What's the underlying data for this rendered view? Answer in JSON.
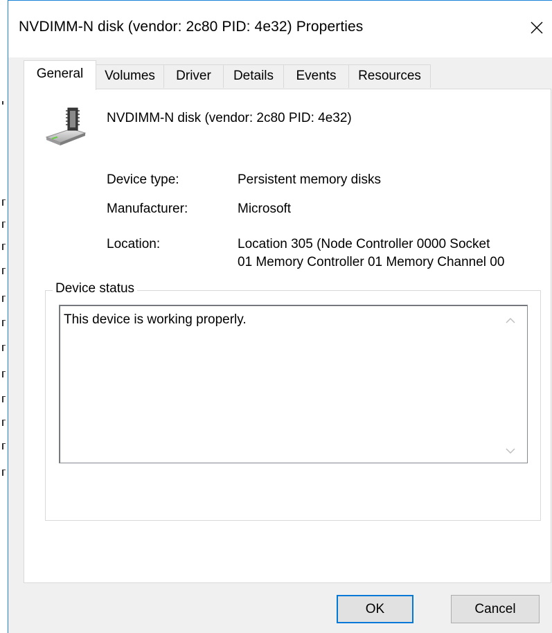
{
  "window": {
    "title": "NVDIMM-N disk (vendor: 2c80 PID: 4e32) Properties",
    "close_icon": "close-icon"
  },
  "tabs": [
    {
      "label": "General",
      "active": true
    },
    {
      "label": "Volumes",
      "active": false
    },
    {
      "label": "Driver",
      "active": false
    },
    {
      "label": "Details",
      "active": false
    },
    {
      "label": "Events",
      "active": false
    },
    {
      "label": "Resources",
      "active": false
    }
  ],
  "general": {
    "device_icon": "disk-drive-icon",
    "device_name": "NVDIMM-N disk (vendor: 2c80 PID: 4e32)",
    "properties": {
      "device_type_label": "Device type:",
      "device_type_value": "Persistent memory disks",
      "manufacturer_label": "Manufacturer:",
      "manufacturer_value": "Microsoft",
      "location_label": "Location:",
      "location_value_line1": "Location 305 (Node Controller 0000 Socket",
      "location_value_line2": "01 Memory Controller 01 Memory Channel 00"
    },
    "status": {
      "group_label": "Device status",
      "text": "This device is working properly."
    }
  },
  "buttons": {
    "ok": "OK",
    "cancel": "Cancel"
  },
  "colors": {
    "accent": "#0078d7",
    "window_border": "#1883d7",
    "dialog_bg": "#f0f0f0"
  }
}
